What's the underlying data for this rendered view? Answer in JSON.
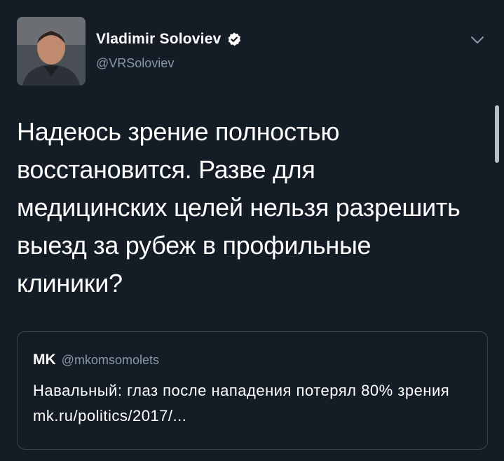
{
  "tweet": {
    "display_name": "Vladimir Soloviev",
    "handle": "@VRSoloviev",
    "verified": true,
    "text": "Надеюсь зрение полностью восстановится. Разве для медицинских целей нельзя разрешить выезд за рубеж в профильные клиники?"
  },
  "quote": {
    "name": "MK",
    "handle": "@mkomsomolets",
    "text": "Навальный: глаз после нападения потерял 80% зрения mk.ru/politics/2017/..."
  },
  "icons": {
    "verified": "verified-badge-icon",
    "caret": "chevron-down-icon"
  },
  "colors": {
    "background": "#141d26",
    "secondary_text": "#8899a6",
    "border": "#38444d",
    "verified_bg": "#ffffff"
  }
}
